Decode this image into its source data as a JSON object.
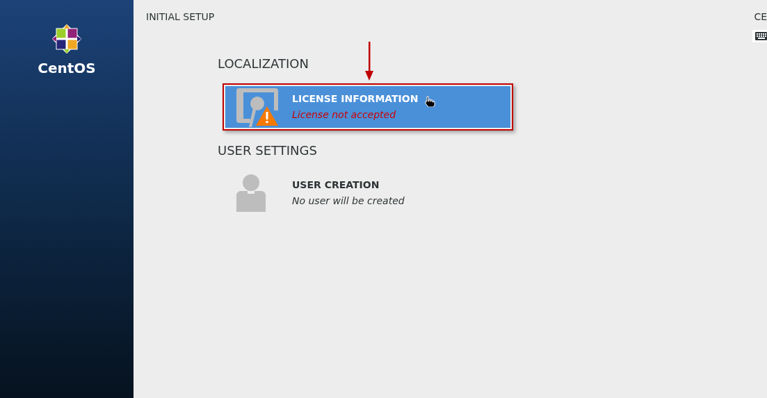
{
  "sidebar": {
    "logo_text": "CentOS"
  },
  "header": {
    "title": "INITIAL SETUP",
    "product": "CE"
  },
  "sections": [
    {
      "title": "LOCALIZATION",
      "spokes": [
        {
          "kind": "license",
          "title": "LICENSE INFORMATION",
          "status": "License not accepted",
          "warning": true,
          "selected": true
        }
      ]
    },
    {
      "title": "USER SETTINGS",
      "spokes": [
        {
          "kind": "user",
          "title": "USER CREATION",
          "status": "No user will be created",
          "warning": false,
          "selected": false
        }
      ]
    }
  ]
}
